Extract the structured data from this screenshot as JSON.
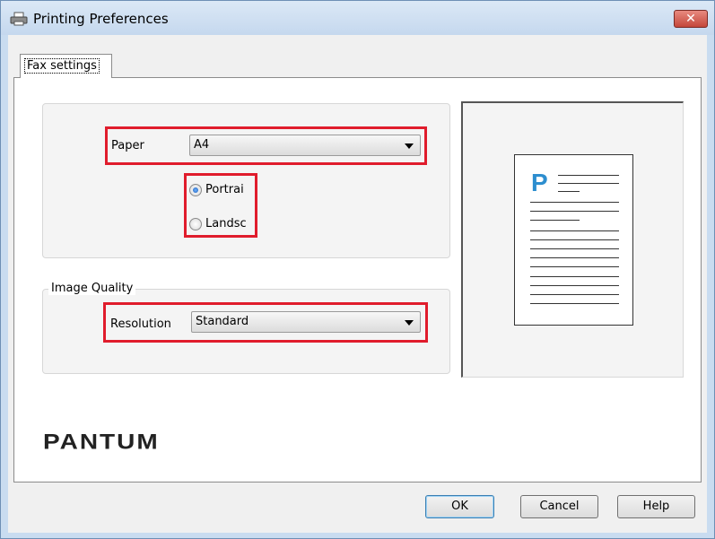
{
  "window": {
    "title": "Printing Preferences",
    "close_symbol": "✕"
  },
  "tabs": [
    {
      "label": "Fax settings"
    }
  ],
  "paper": {
    "label": "Paper",
    "value": "A4",
    "orientation": {
      "options": [
        {
          "label": "Portrai",
          "checked": true
        },
        {
          "label": "Landsc",
          "checked": false
        }
      ]
    }
  },
  "image_quality": {
    "legend": "Image Quality",
    "resolution_label": "Resolution",
    "resolution_value": "Standard"
  },
  "preview": {
    "page_letter": "P",
    "accent_color": "#2d8ecf"
  },
  "branding": {
    "logo_text": "PANTUM"
  },
  "buttons": {
    "ok": "OK",
    "cancel": "Cancel",
    "help": "Help"
  },
  "colors": {
    "highlight": "#e01c2c",
    "titlebar": "#c9dcf0"
  }
}
